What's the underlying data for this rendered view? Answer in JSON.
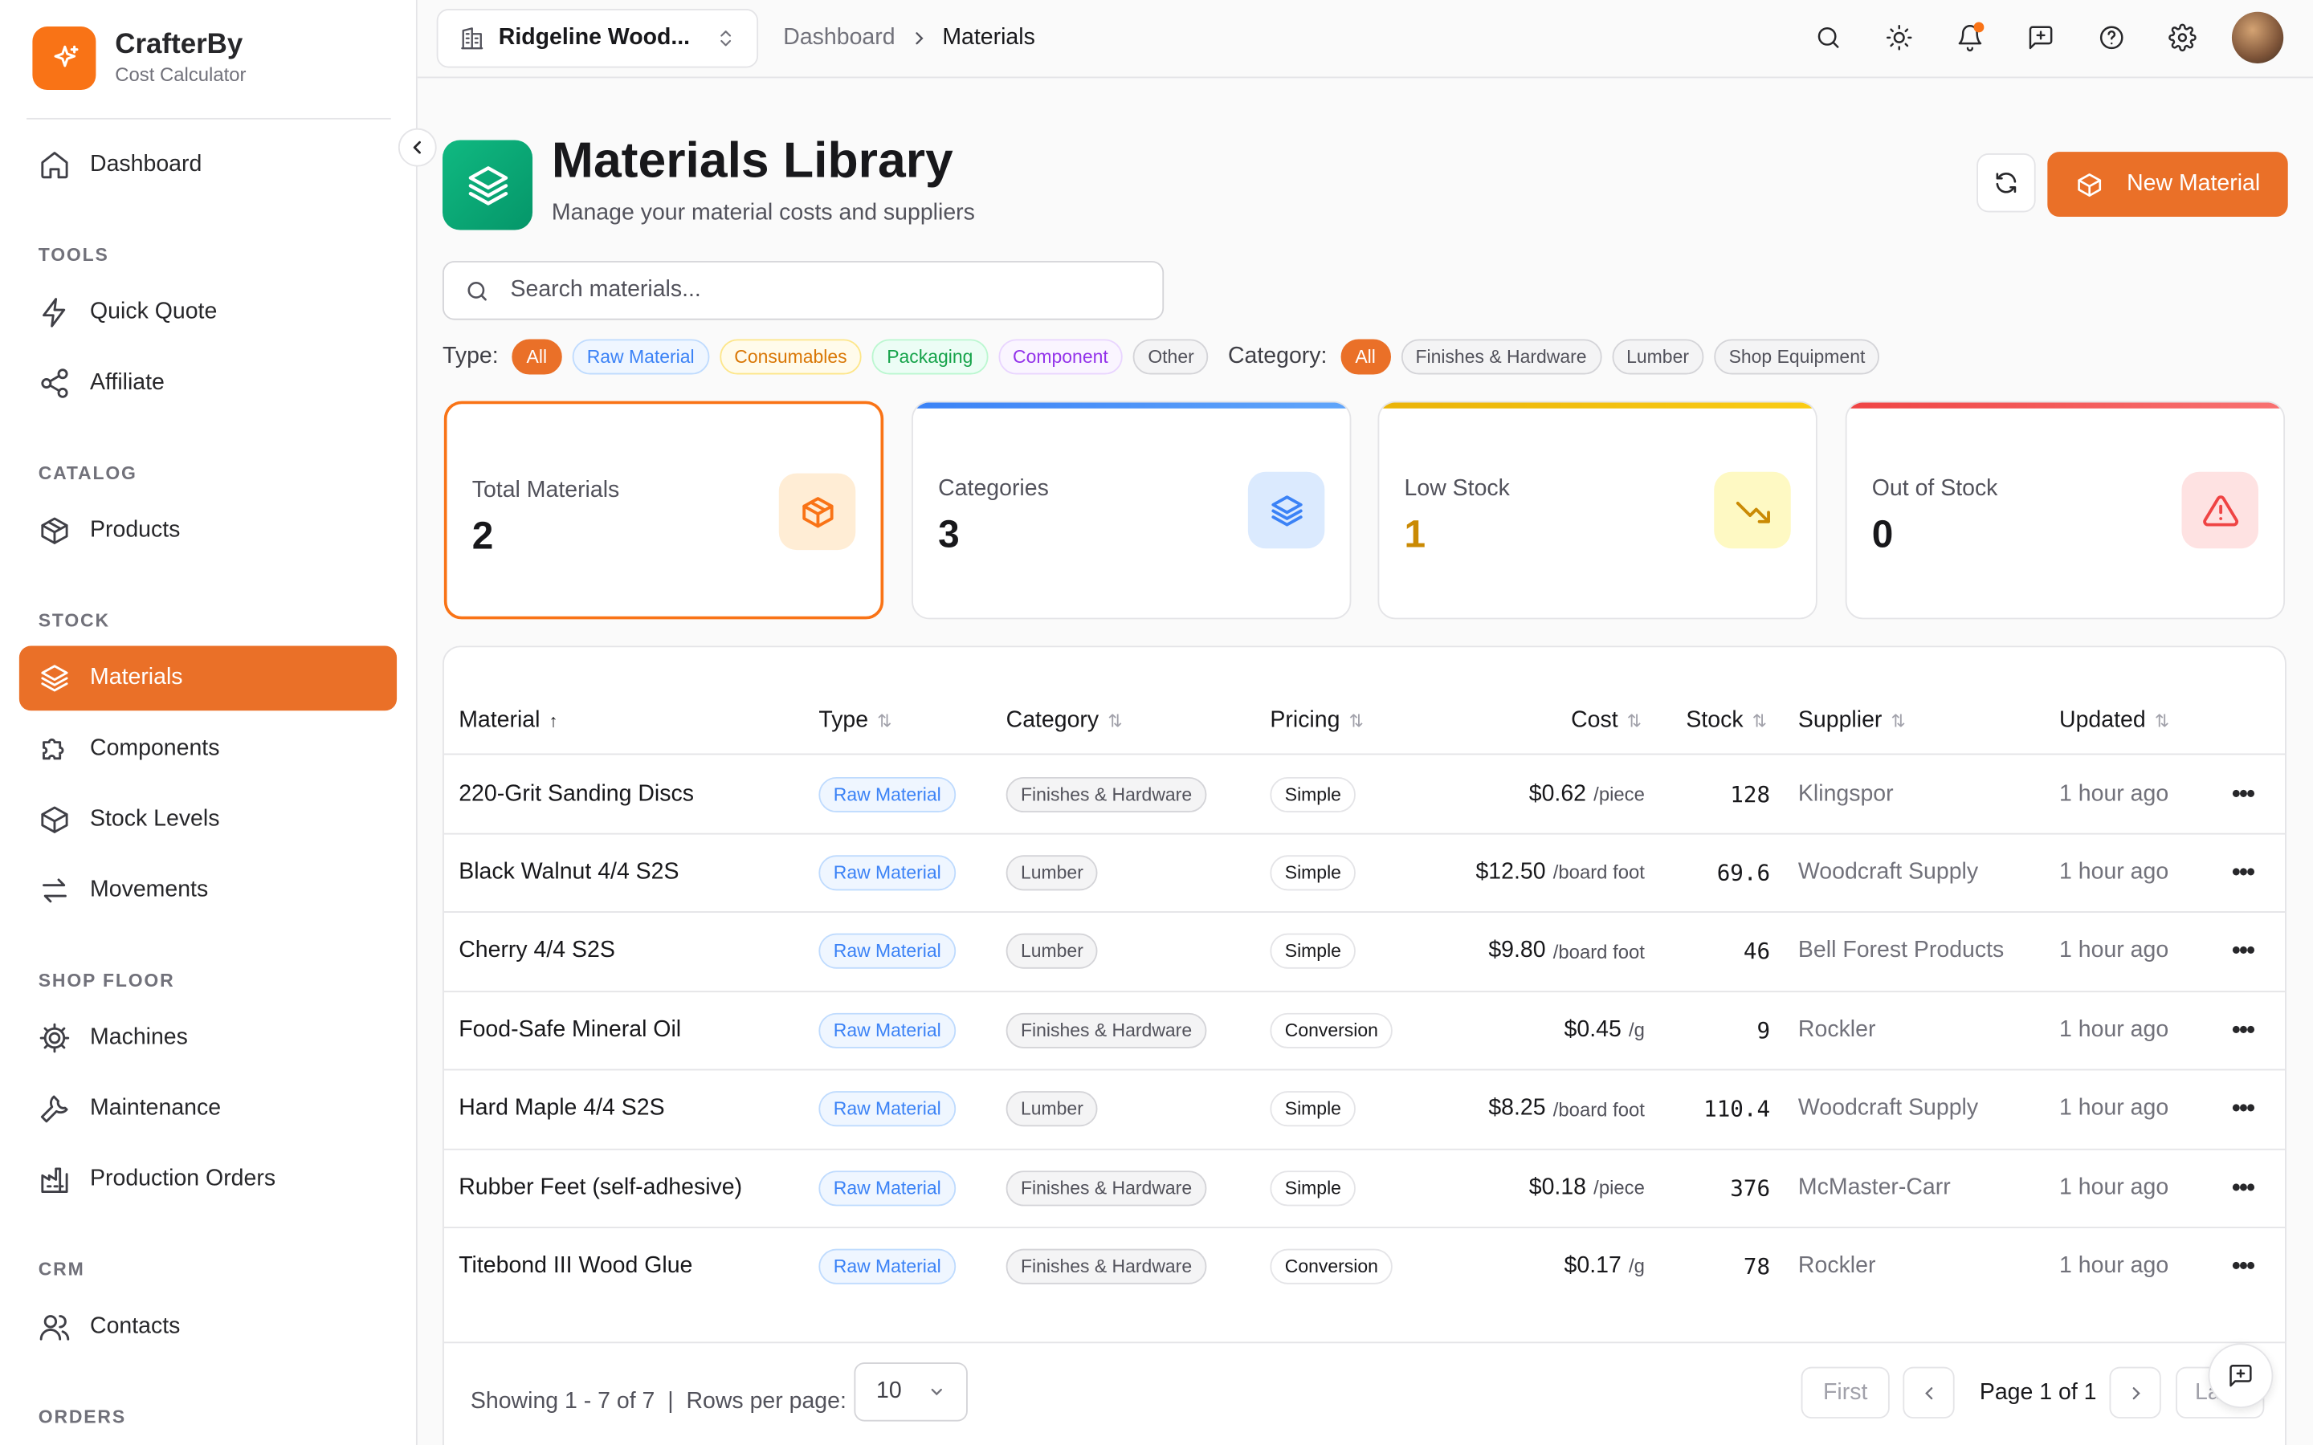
{
  "brand": {
    "name": "CrafterBy",
    "subtitle": "Cost Calculator"
  },
  "sidebar": {
    "items": [
      {
        "label": "Dashboard",
        "icon": "home-icon"
      },
      {
        "label": "Quick Quote",
        "icon": "zap-icon"
      },
      {
        "label": "Affiliate",
        "icon": "share-icon"
      },
      {
        "label": "Products",
        "icon": "box-icon"
      },
      {
        "label": "Materials",
        "icon": "layers-icon",
        "active": true
      },
      {
        "label": "Components",
        "icon": "puzzle-icon"
      },
      {
        "label": "Stock Levels",
        "icon": "box-icon"
      },
      {
        "label": "Movements",
        "icon": "arrows-icon"
      },
      {
        "label": "Machines",
        "icon": "cog-icon"
      },
      {
        "label": "Maintenance",
        "icon": "wrench-icon"
      },
      {
        "label": "Production Orders",
        "icon": "factory-icon"
      },
      {
        "label": "Contacts",
        "icon": "users-icon"
      }
    ],
    "sections": {
      "tools": "TOOLS",
      "catalog": "CATALOG",
      "stock": "STOCK",
      "shop_floor": "SHOP FLOOR",
      "crm": "CRM",
      "orders": "ORDERS"
    }
  },
  "topbar": {
    "org": "Ridgeline Wood...",
    "breadcrumb": [
      "Dashboard",
      "Materials"
    ]
  },
  "page": {
    "title": "Materials Library",
    "subtitle": "Manage your material costs and suppliers",
    "new_button": "New Material"
  },
  "search": {
    "placeholder": "Search materials..."
  },
  "filters": {
    "type_label": "Type:",
    "types": [
      "All",
      "Raw Material",
      "Consumables",
      "Packaging",
      "Component",
      "Other"
    ],
    "category_label": "Category:",
    "categories": [
      "All",
      "Finishes & Hardware",
      "Lumber",
      "Shop Equipment"
    ]
  },
  "stats": [
    {
      "label": "Total Materials",
      "value": "2",
      "color": "#f97316"
    },
    {
      "label": "Categories",
      "value": "3",
      "color": "#3b82f6"
    },
    {
      "label": "Low Stock",
      "value": "1",
      "color": "#eab308"
    },
    {
      "label": "Out of Stock",
      "value": "0",
      "color": "#ef4444"
    }
  ],
  "table": {
    "columns": [
      "Material",
      "Type",
      "Category",
      "Pricing",
      "Cost",
      "Stock",
      "Supplier",
      "Updated"
    ],
    "rows": [
      {
        "material": "220-Grit Sanding Discs",
        "type": "Raw Material",
        "category": "Finishes & Hardware",
        "pricing": "Simple",
        "cost": "$0.62",
        "unit": "/piece",
        "stock": "128",
        "supplier": "Klingspor",
        "updated": "1 hour ago"
      },
      {
        "material": "Black Walnut 4/4 S2S",
        "type": "Raw Material",
        "category": "Lumber",
        "pricing": "Simple",
        "cost": "$12.50",
        "unit": "/board foot",
        "stock": "69.6",
        "supplier": "Woodcraft Supply",
        "updated": "1 hour ago"
      },
      {
        "material": "Cherry 4/4 S2S",
        "type": "Raw Material",
        "category": "Lumber",
        "pricing": "Simple",
        "cost": "$9.80",
        "unit": "/board foot",
        "stock": "46",
        "supplier": "Bell Forest Products",
        "updated": "1 hour ago"
      },
      {
        "material": "Food-Safe Mineral Oil",
        "type": "Raw Material",
        "category": "Finishes & Hardware",
        "pricing": "Conversion",
        "cost": "$0.45",
        "unit": "/g",
        "stock": "9",
        "supplier": "Rockler",
        "updated": "1 hour ago"
      },
      {
        "material": "Hard Maple 4/4 S2S",
        "type": "Raw Material",
        "category": "Lumber",
        "pricing": "Simple",
        "cost": "$8.25",
        "unit": "/board foot",
        "stock": "110.4",
        "supplier": "Woodcraft Supply",
        "updated": "1 hour ago"
      },
      {
        "material": "Rubber Feet (self-adhesive)",
        "type": "Raw Material",
        "category": "Finishes & Hardware",
        "pricing": "Simple",
        "cost": "$0.18",
        "unit": "/piece",
        "stock": "376",
        "supplier": "McMaster-Carr",
        "updated": "1 hour ago"
      },
      {
        "material": "Titebond III Wood Glue",
        "type": "Raw Material",
        "category": "Finishes & Hardware",
        "pricing": "Conversion",
        "cost": "$0.17",
        "unit": "/g",
        "stock": "78",
        "supplier": "Rockler",
        "updated": "1 hour ago"
      }
    ]
  },
  "pagination": {
    "showing": "Showing 1 - 7 of 7",
    "rows_per_page_label": "Rows per page:",
    "rows_per_page": "10",
    "first": "First",
    "page_info": "Page 1 of 1",
    "last": "La"
  }
}
